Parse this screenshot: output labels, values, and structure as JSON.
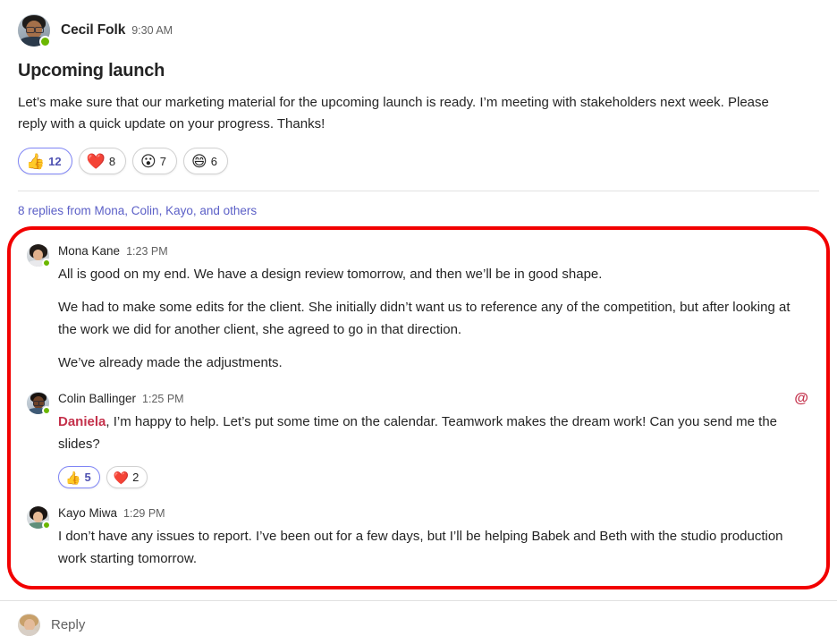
{
  "root_post": {
    "author": "Cecil Folk",
    "timestamp": "9:30 AM",
    "subject": "Upcoming launch",
    "body": "Let’s make sure that our marketing material for the upcoming launch is ready. I’m meeting with stakeholders next week. Please reply with a quick update on your progress. Thanks!",
    "avatar_name": "cecil-folk-avatar",
    "presence": "available",
    "reactions": [
      {
        "icon": "thumbs-up-emoji",
        "glyph": "👍",
        "count": "12",
        "selected": true
      },
      {
        "icon": "heart-emoji",
        "glyph": "❤️",
        "count": "8",
        "selected": false
      },
      {
        "icon": "surprised-face-emoji",
        "glyph": "😮",
        "count": "7",
        "selected": false
      },
      {
        "icon": "laughing-face-emoji",
        "glyph": "😄",
        "count": "6",
        "selected": false
      }
    ]
  },
  "replies_link": "8 replies from Mona, Colin, Kayo, and others",
  "highlight": {
    "color": "#f20000",
    "name": "replies-highlight-outline"
  },
  "replies": [
    {
      "author": "Mona Kane",
      "timestamp": "1:23 PM",
      "avatar_name": "mona-kane-avatar",
      "presence": "available",
      "paragraphs": [
        "All is good on my end. We have a design review tomorrow, and then we’ll be in good shape.",
        "We had to make some edits for the client. She initially didn’t want us to reference any of the competition, but after looking at the work we did for another client, she agreed to go in that direction.",
        "We’ve already made the adjustments."
      ],
      "mention": null,
      "has_mention_badge": false,
      "reactions": []
    },
    {
      "author": "Colin Ballinger",
      "timestamp": "1:25 PM",
      "avatar_name": "colin-ballinger-avatar",
      "presence": "available",
      "mention": "Daniela",
      "paragraphs": [
        ", I’m happy to help. Let’s put some time on the calendar. Teamwork makes the dream work! Can you send me the slides?"
      ],
      "has_mention_badge": true,
      "mention_badge_glyph": "@",
      "reactions": [
        {
          "icon": "thumbs-up-emoji",
          "glyph": "👍",
          "count": "5",
          "selected": true
        },
        {
          "icon": "heart-emoji",
          "glyph": "❤️",
          "count": "2",
          "selected": false
        }
      ]
    },
    {
      "author": "Kayo Miwa",
      "timestamp": "1:29 PM",
      "avatar_name": "kayo-miwa-avatar",
      "presence": "available",
      "paragraphs": [
        "I don’t have any issues to report. I’ve been out for a few days, but I’ll be helping Babek and Beth with the studio production work starting tomorrow."
      ],
      "mention": null,
      "has_mention_badge": false,
      "reactions": []
    }
  ],
  "composer": {
    "placeholder": "Reply",
    "avatar_name": "current-user-avatar"
  },
  "colors": {
    "link": "#5b5fc7",
    "mention": "#c4314b",
    "highlight": "#f20000",
    "presence_available": "#6bb700",
    "text_primary": "#242424",
    "text_secondary": "#616161"
  }
}
